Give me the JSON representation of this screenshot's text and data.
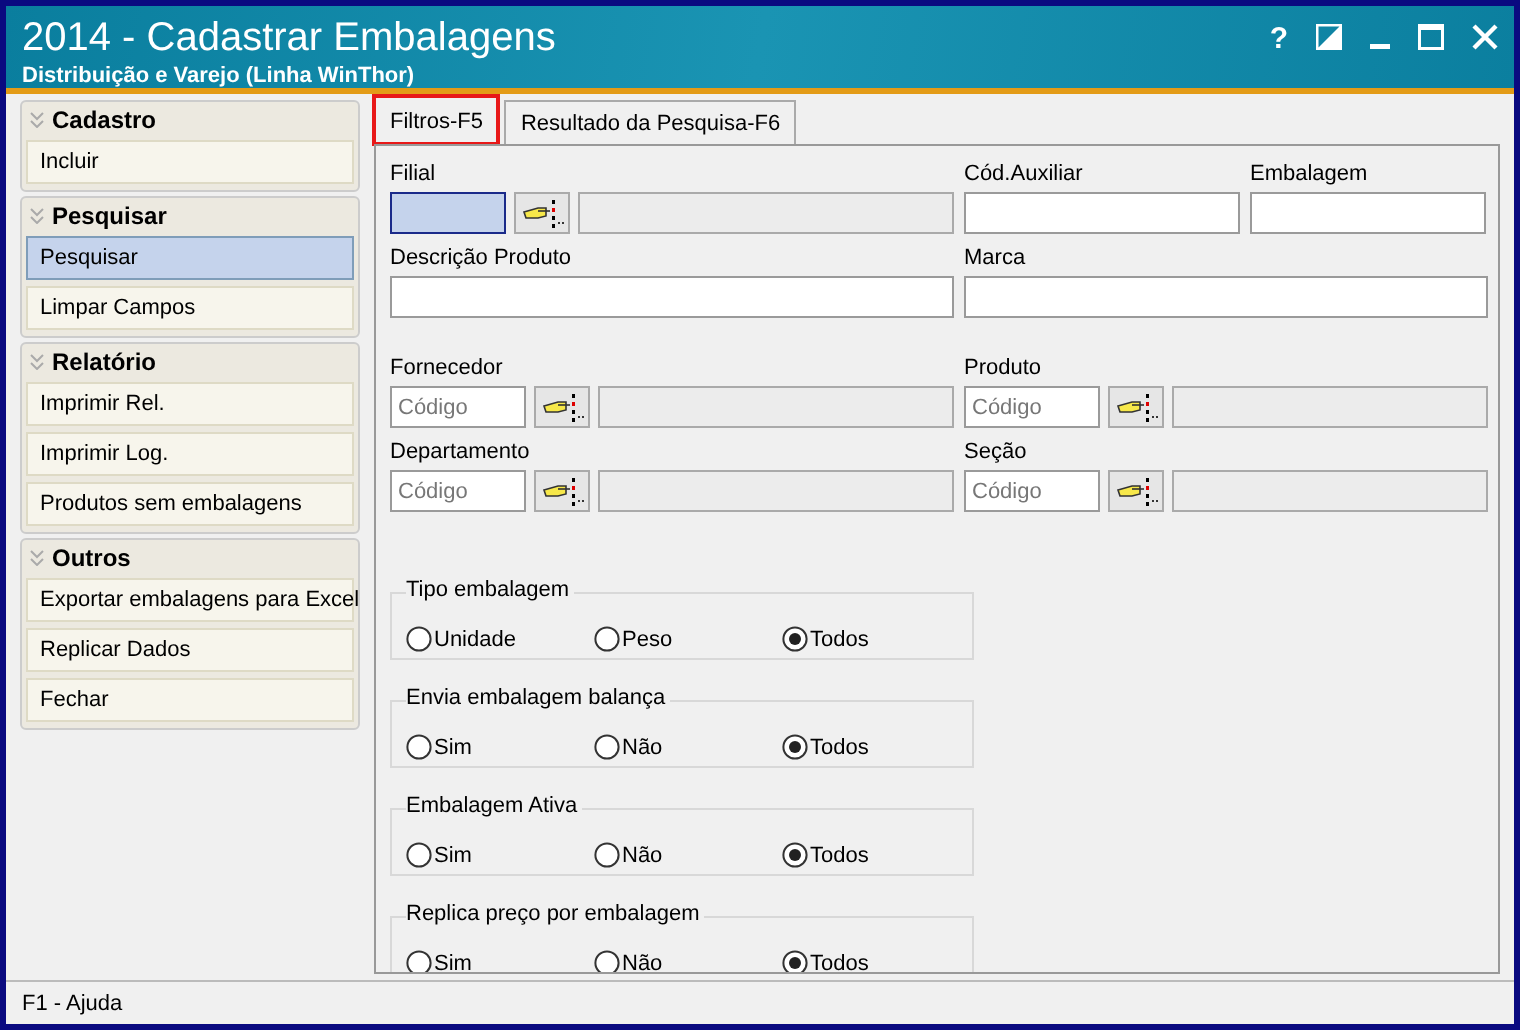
{
  "window": {
    "title": "2014 - Cadastrar Embalagens",
    "subtitle": "Distribuição e Varejo (Linha WinThor)",
    "help": "?"
  },
  "sidebar": {
    "groups": [
      {
        "title": "Cadastro",
        "items": [
          {
            "label": "Incluir",
            "selected": false
          }
        ]
      },
      {
        "title": "Pesquisar",
        "items": [
          {
            "label": "Pesquisar",
            "selected": true
          },
          {
            "label": "Limpar Campos",
            "selected": false
          }
        ]
      },
      {
        "title": "Relatório",
        "items": [
          {
            "label": "Imprimir Rel.",
            "selected": false
          },
          {
            "label": "Imprimir Log.",
            "selected": false
          },
          {
            "label": "Produtos sem embalagens",
            "selected": false
          }
        ]
      },
      {
        "title": "Outros",
        "items": [
          {
            "label": "Exportar embalagens para Excel",
            "selected": false
          },
          {
            "label": "Replicar Dados",
            "selected": false
          },
          {
            "label": "Fechar",
            "selected": false
          }
        ]
      }
    ]
  },
  "tabs": [
    {
      "label": "Filtros-F5",
      "selected": true,
      "highlighted": true
    },
    {
      "label": "Resultado da Pesquisa-F6",
      "selected": false,
      "highlighted": false
    }
  ],
  "form": {
    "rows": [
      [
        {
          "kind": "lookup",
          "label": "Filial",
          "focused": true
        },
        {
          "kind": "text",
          "label": "Cód.Auxiliar"
        },
        {
          "kind": "text",
          "label": "Embalagem"
        }
      ],
      [
        {
          "kind": "text",
          "label": "Descrição Produto"
        },
        {
          "kind": "text",
          "label": "Marca"
        }
      ],
      [
        {
          "kind": "lookup",
          "label": "Fornecedor",
          "placeholder": "Código",
          "focused": false
        },
        {
          "kind": "lookup",
          "label": "Produto",
          "placeholder": "Código",
          "focused": false
        }
      ],
      [
        {
          "kind": "lookup",
          "label": "Departamento",
          "placeholder": "Código",
          "focused": false
        },
        {
          "kind": "lookup",
          "label": "Seção",
          "placeholder": "Código",
          "focused": false
        }
      ]
    ],
    "radio_groups": [
      {
        "title": "Tipo embalagem",
        "options": [
          {
            "label": "Unidade",
            "selected": false
          },
          {
            "label": "Peso",
            "selected": false
          },
          {
            "label": "Todos",
            "selected": true
          }
        ]
      },
      {
        "title": "Envia embalagem balança",
        "options": [
          {
            "label": "Sim",
            "selected": false
          },
          {
            "label": "Não",
            "selected": false
          },
          {
            "label": "Todos",
            "selected": true
          }
        ]
      },
      {
        "title": "Embalagem Ativa",
        "options": [
          {
            "label": "Sim",
            "selected": false
          },
          {
            "label": "Não",
            "selected": false
          },
          {
            "label": "Todos",
            "selected": true
          }
        ]
      },
      {
        "title": "Replica preço por embalagem",
        "options": [
          {
            "label": "Sim",
            "selected": false
          },
          {
            "label": "Não",
            "selected": false
          },
          {
            "label": "Todos",
            "selected": true
          }
        ]
      }
    ]
  },
  "status_bar": "F1 - Ajuda"
}
